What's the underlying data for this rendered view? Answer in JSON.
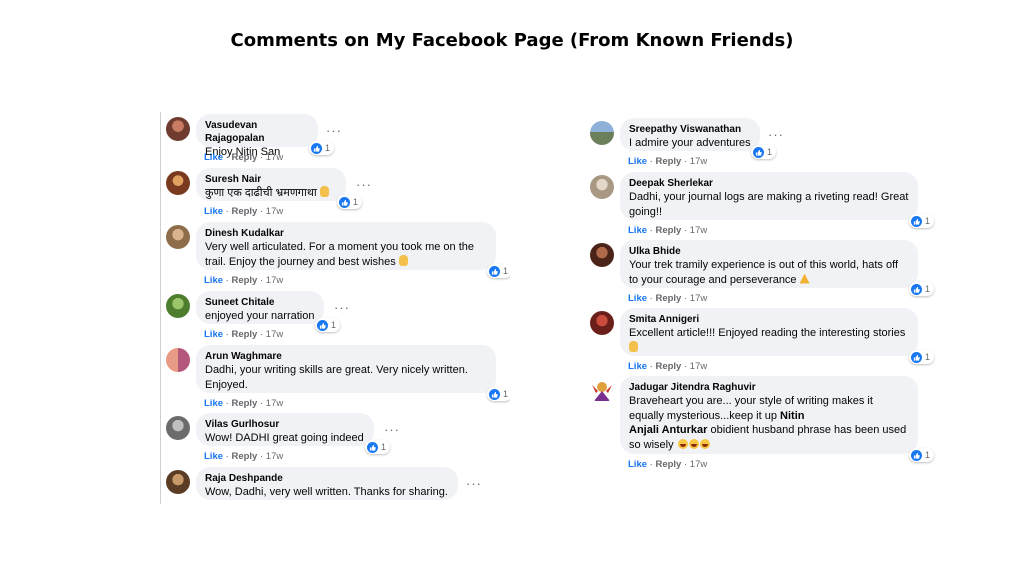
{
  "title": "Comments on My Facebook Page (From Known Friends)",
  "actions": {
    "like": "Like",
    "reply": "Reply",
    "sep": "·"
  },
  "colors": {
    "accent": "#1877f2",
    "bubble": "#f0f2f5",
    "meta": "#65676b"
  },
  "left_comments": [
    {
      "name": "Vasudevan Rajagopalan",
      "text": [
        "Enjoy Nitin San"
      ],
      "age": "17w",
      "reactions": "1"
    },
    {
      "name": "Suresh Nair",
      "text": [
        "कुणा एक दाढीची भ्रमणगाथा"
      ],
      "age": "17w",
      "reactions": "1"
    },
    {
      "name": "Dinesh Kudalkar",
      "text": [
        "Very well articulated. For a moment you took me on the",
        "trail. Enjoy the journey and best wishes"
      ],
      "age": "17w",
      "reactions": "1"
    },
    {
      "name": "Suneet Chitale",
      "text": [
        "enjoyed your narration"
      ],
      "age": "17w",
      "reactions": "1"
    },
    {
      "name": "Arun Waghmare",
      "text": [
        "Dadhi, your writing skills are great. Very nicely written.",
        "Enjoyed."
      ],
      "age": "17w",
      "reactions": "1"
    },
    {
      "name": "Vilas Gurlhosur",
      "text": [
        "Wow! DADHI great going indeed"
      ],
      "age": "17w",
      "reactions": "1"
    },
    {
      "name": "Raja Deshpande",
      "text": [
        "Wow, Dadhi, very well written. Thanks for sharing."
      ],
      "age": "",
      "reactions": ""
    }
  ],
  "right_comments": [
    {
      "name": "Sreepathy Viswanathan",
      "text": [
        "I admire your adventures"
      ],
      "age": "17w",
      "reactions": "1"
    },
    {
      "name": "Deepak Sherlekar",
      "text": [
        "Dadhi, your journal logs are making a riveting read! Great",
        "going!!"
      ],
      "age": "17w",
      "reactions": "1"
    },
    {
      "name": "Ulka Bhide",
      "text": [
        "Your trek tramily experience is out of this world, hats off",
        "to your courage and perseverance"
      ],
      "age": "17w",
      "reactions": "1"
    },
    {
      "name": "Smita Annigeri",
      "text": [
        "Excellent article!!! Enjoyed reading the interesting stories",
        ""
      ],
      "age": "17w",
      "reactions": "1"
    },
    {
      "name": "Jadugar Jitendra Raghuvir",
      "text": [
        "Braveheart you are... your style of writing makes it",
        "equally mysterious...keep it up",
        "Nitin",
        "Anjali Anturkar",
        "obidient husband phrase has been used",
        "so wisely"
      ],
      "age": "17w",
      "reactions": "1"
    }
  ]
}
